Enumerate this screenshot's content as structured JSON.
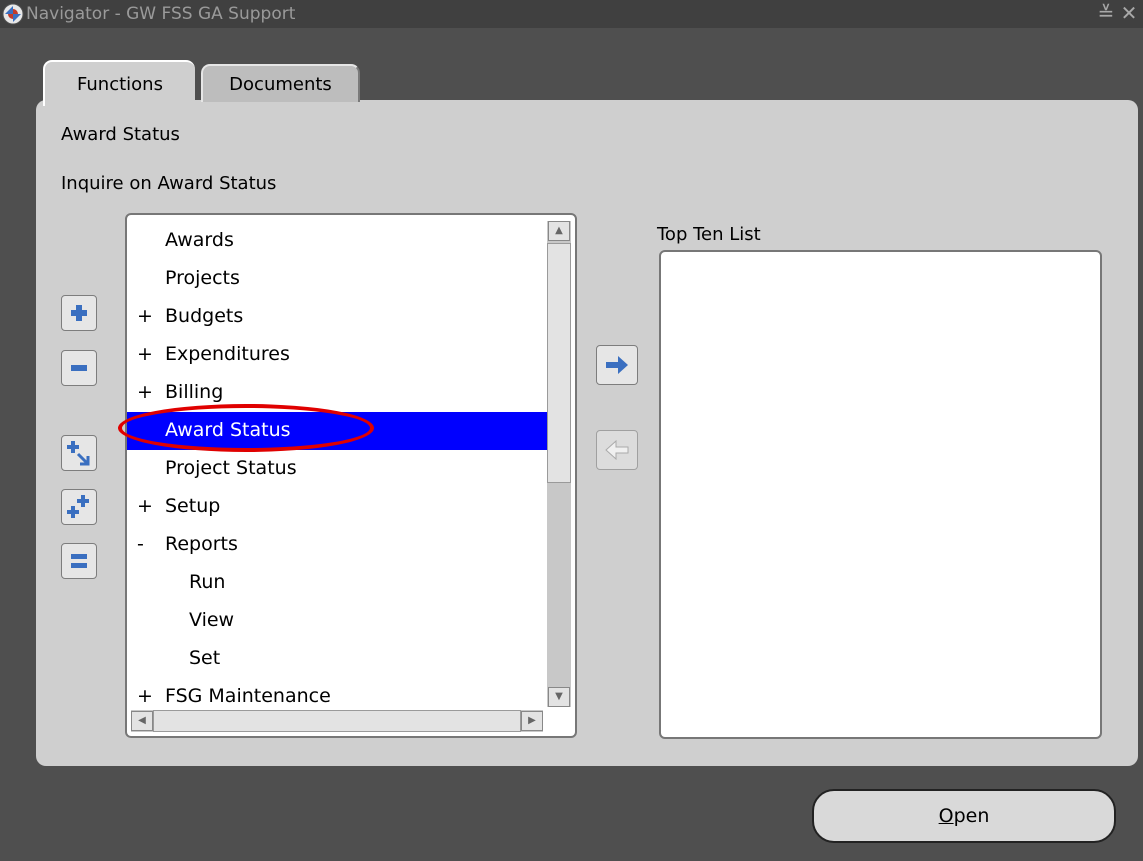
{
  "window": {
    "title": "Navigator - GW FSS GA Support",
    "minimize_glyph": "≚",
    "close_glyph": "✕"
  },
  "tabs": [
    {
      "label": "Functions",
      "active": true
    },
    {
      "label": "Documents",
      "active": false
    }
  ],
  "selection": {
    "name": "Award Status",
    "description": "Inquire on Award Status"
  },
  "tree": {
    "items": [
      {
        "prefix": "",
        "label": "Awards",
        "indent": 0,
        "selected": false
      },
      {
        "prefix": "",
        "label": "Projects",
        "indent": 0,
        "selected": false
      },
      {
        "prefix": "+",
        "label": "Budgets",
        "indent": 0,
        "selected": false
      },
      {
        "prefix": "+",
        "label": "Expenditures",
        "indent": 0,
        "selected": false
      },
      {
        "prefix": "+",
        "label": "Billing",
        "indent": 0,
        "selected": false
      },
      {
        "prefix": "",
        "label": "Award Status",
        "indent": 0,
        "selected": true
      },
      {
        "prefix": "",
        "label": "Project Status",
        "indent": 0,
        "selected": false
      },
      {
        "prefix": "+",
        "label": "Setup",
        "indent": 0,
        "selected": false
      },
      {
        "prefix": "-",
        "label": "Reports",
        "indent": 0,
        "selected": false
      },
      {
        "prefix": "",
        "label": "Run",
        "indent": 1,
        "selected": false
      },
      {
        "prefix": "",
        "label": "View",
        "indent": 1,
        "selected": false
      },
      {
        "prefix": "",
        "label": "Set",
        "indent": 1,
        "selected": false
      },
      {
        "prefix": "+",
        "label": "FSG Maintenance",
        "indent": 0,
        "selected": false
      }
    ]
  },
  "top_ten": {
    "label": "Top Ten List",
    "items": []
  },
  "buttons": {
    "open_label_mnemonic": "O",
    "open_label_rest": "pen"
  },
  "colors": {
    "selection": "#0000ff",
    "highlight_ring": "#e00000",
    "icon_blue": "#3a6fc0"
  }
}
